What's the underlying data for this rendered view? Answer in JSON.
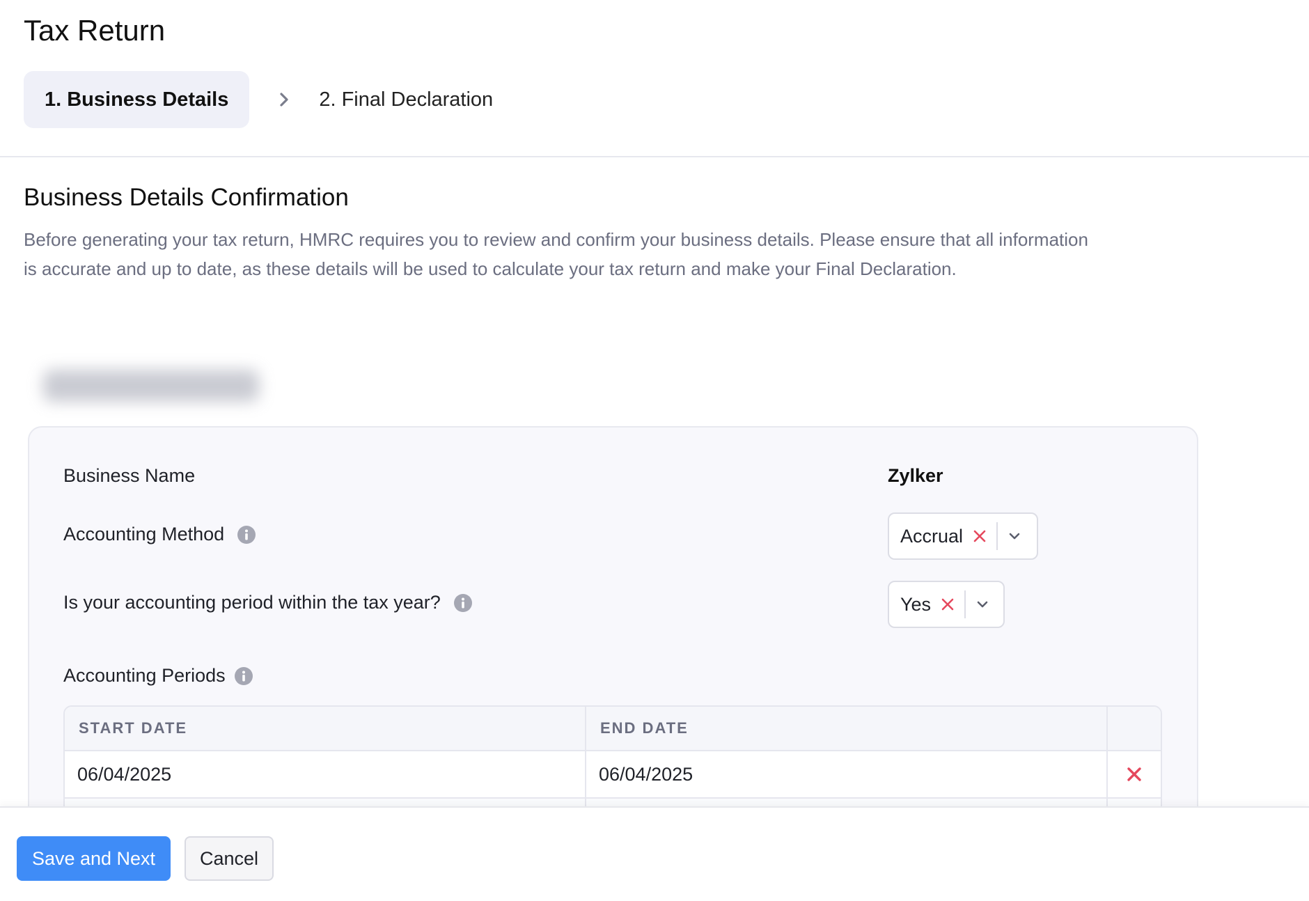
{
  "page": {
    "title": "Tax Return"
  },
  "stepper": {
    "steps": [
      {
        "label": "1. Business Details",
        "active": true
      },
      {
        "label": "2. Final Declaration",
        "active": false
      }
    ]
  },
  "section": {
    "title": "Business Details Confirmation",
    "description": "Before generating your tax return, HMRC requires you to review and confirm your business details. Please ensure that all information is accurate and up to date, as these details will be used to calculate your tax return and make your Final Declaration."
  },
  "details": {
    "business_name_label": "Business Name",
    "business_name_value": "Zylker",
    "accounting_method_label": "Accounting Method",
    "accounting_method_value": "Accrual",
    "period_within_tax_year_label": "Is your accounting period within the tax year?",
    "period_within_tax_year_value": "Yes",
    "accounting_periods_label": "Accounting Periods"
  },
  "periods_table": {
    "columns": [
      "START DATE",
      "END DATE"
    ],
    "rows": [
      {
        "start": "06/04/2025",
        "end": "06/04/2025"
      }
    ]
  },
  "footer": {
    "save_label": "Save and Next",
    "cancel_label": "Cancel"
  },
  "colors": {
    "primary": "#3f8cf7",
    "danger": "#e5485d",
    "muted_text": "#6b6e80",
    "active_step_bg": "#eff0f8"
  },
  "icons": [
    "chevron-right-icon",
    "info-icon",
    "clear-x-icon",
    "chevron-down-icon",
    "delete-row-icon"
  ]
}
